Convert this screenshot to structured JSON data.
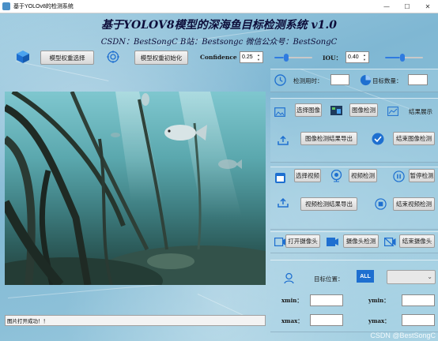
{
  "window": {
    "title": "基于YOLOv8的检测系统",
    "controls": [
      "—",
      "☐",
      "✕"
    ]
  },
  "header": {
    "title": "基于YOLOV8模型的深海鱼目标检测系统 v1.0",
    "subtitle": "CSDN：BestSongC   B站：Bestsongc   微信公众号：BestSongC"
  },
  "toolbar": {
    "select_weights_label": "模型权重选择",
    "init_weights_label": "模型权重初始化",
    "confidence_label": "Confidence",
    "confidence_value": "0.25",
    "confidence_fraction": 0.25,
    "iou_label": "IOU：",
    "iou_value": "0.40",
    "iou_fraction": 0.4
  },
  "stats": {
    "time_label": "检测用时：",
    "time_value": "",
    "count_label": "目标数量：",
    "count_value": ""
  },
  "image_panel": {
    "select_image_label": "选择图像",
    "detect_image_label": "图像检测",
    "show_results_label": "结果展示",
    "export_image_label": "图像检测结果导出",
    "end_image_label": "结束图像检测"
  },
  "video_panel": {
    "select_video_label": "选择视频",
    "detect_video_label": "视频检测",
    "pause_label": "暂停检测",
    "export_video_label": "视频检测结果导出",
    "end_video_label": "结束视频检测"
  },
  "camera_panel": {
    "open_camera_label": "打开摄像头",
    "detect_camera_label": "摄像头检测",
    "close_camera_label": "结束摄像头"
  },
  "target_panel": {
    "position_label": "目标位置：",
    "all_label": "ALL",
    "select_value": "",
    "xmin_label": "xmin：",
    "xmax_label": "xmax：",
    "ymin_label": "ymin：",
    "ymax_label": "ymax：",
    "xmin_value": "",
    "xmax_value": "",
    "ymin_value": "",
    "ymax_value": ""
  },
  "status": {
    "message": "图片打开成功！！"
  },
  "watermark": "CSDN @BestSongC",
  "colors": {
    "accent_blue": "#2f7be0",
    "title_color": "#0d0d3a",
    "icon_blue": "#1e6fd0"
  }
}
